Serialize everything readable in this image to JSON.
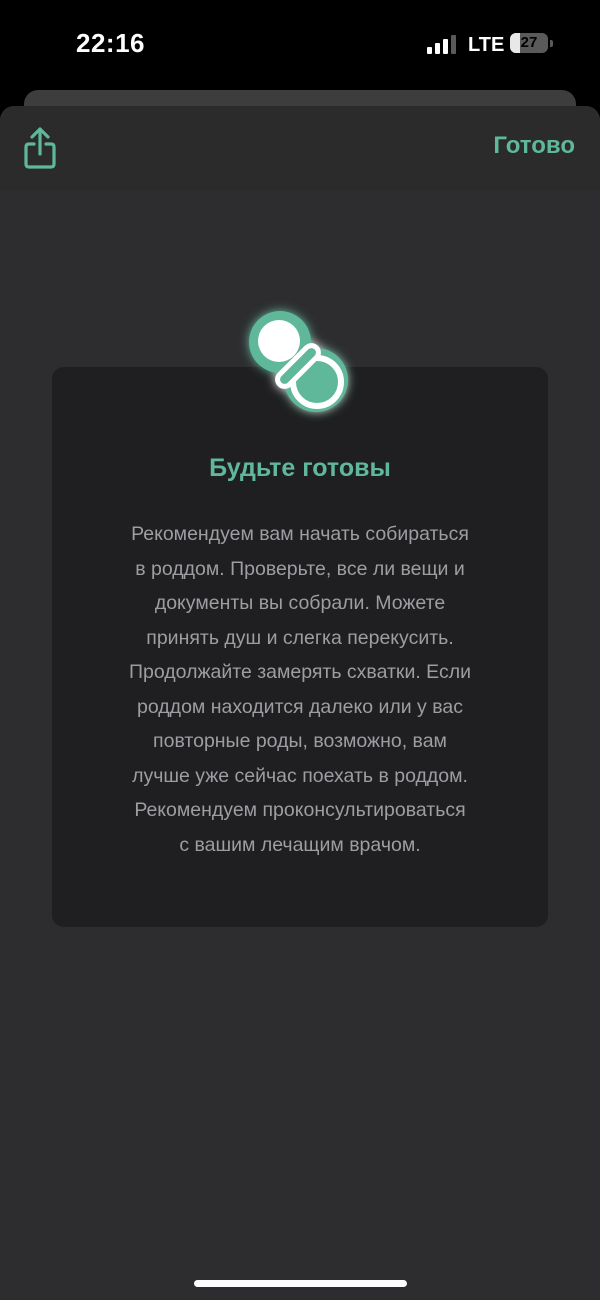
{
  "status_bar": {
    "time": "22:16",
    "network": "LTE",
    "battery_level": "27",
    "battery_percent": 27,
    "signal_bars_active": 3
  },
  "header": {
    "share_icon": "share-icon",
    "done_label": "Готово"
  },
  "card": {
    "icon": "pacifier-icon",
    "title": "Будьте готовы",
    "body_lines": [
      "Рекомендуем вам начать собираться",
      "в роддом. Проверьте, все ли вещи и",
      "документы вы собрали. Можете",
      "принять душ и слегка перекусить.",
      "Продолжайте замерять схватки. Если",
      "роддом находится далеко или у вас",
      "повторные роды, возможно, вам",
      "лучше уже сейчас поехать в роддом.",
      "Рекомендуем проконсультироваться",
      "с вашим лечащим врачом."
    ]
  },
  "colors": {
    "accent": "#5fb89a",
    "sheet_background": "#2d2d2f",
    "card_background": "#1f1f21",
    "body_text": "#9d9da2"
  }
}
